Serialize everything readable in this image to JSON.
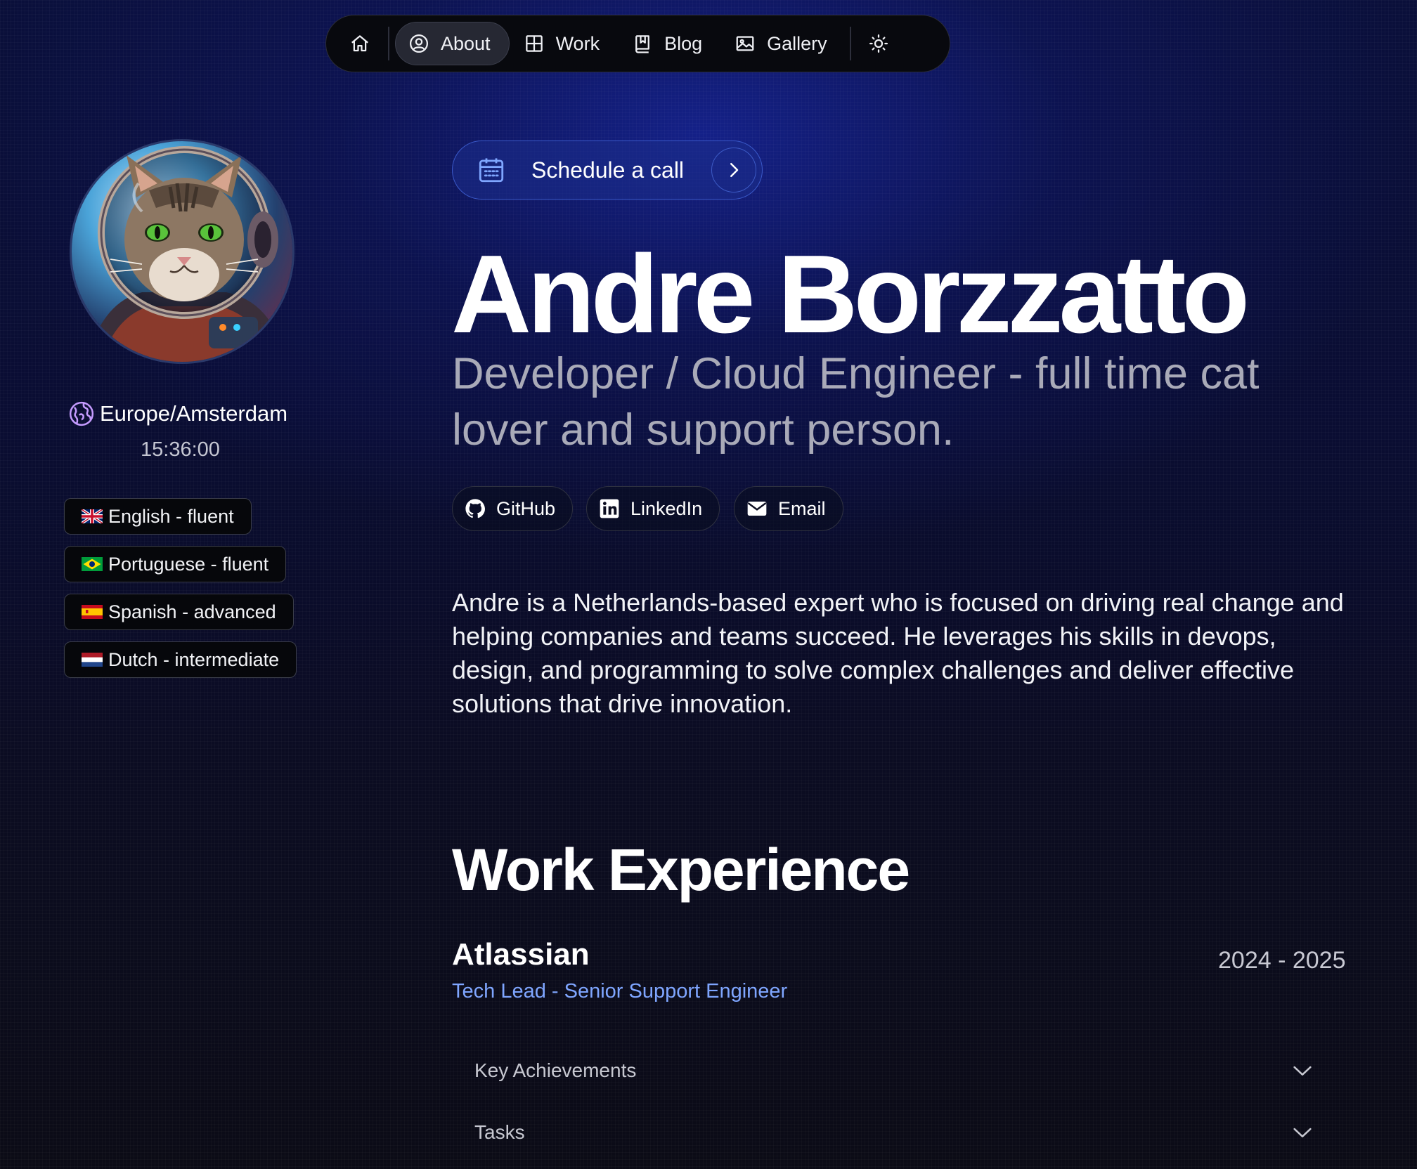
{
  "nav": {
    "items": [
      {
        "id": "home",
        "label": ""
      },
      {
        "id": "about",
        "label": "About",
        "active": true
      },
      {
        "id": "work",
        "label": "Work"
      },
      {
        "id": "blog",
        "label": "Blog"
      },
      {
        "id": "gallery",
        "label": "Gallery"
      }
    ]
  },
  "profile": {
    "timezone": "Europe/Amsterdam",
    "time": "15:36:00",
    "languages": [
      {
        "label": "English - fluent",
        "flag": "uk"
      },
      {
        "label": "Portuguese - fluent",
        "flag": "br"
      },
      {
        "label": "Spanish - advanced",
        "flag": "es"
      },
      {
        "label": "Dutch - intermediate",
        "flag": "nl"
      }
    ]
  },
  "hero": {
    "schedule_label": "Schedule a call",
    "name": "Andre Borzzatto",
    "role": "Developer / Cloud Engineer - full time cat lover and support person.",
    "social": [
      {
        "label": "GitHub",
        "icon": "github-icon"
      },
      {
        "label": "LinkedIn",
        "icon": "linkedin-icon"
      },
      {
        "label": "Email",
        "icon": "email-icon"
      }
    ],
    "bio": "Andre is a Netherlands-based expert who is focused on driving real change and helping companies and teams succeed. He leverages his skills in devops, design, and programming to solve complex challenges and deliver effective solutions that drive innovation."
  },
  "work": {
    "title": "Work Experience",
    "entries": [
      {
        "company": "Atlassian",
        "years": "2024 - 2025",
        "role": "Tech Lead - Senior Support Engineer",
        "sections": [
          "Key Achievements",
          "Tasks"
        ]
      }
    ]
  },
  "colors": {
    "accent": "#7fa6ff",
    "background": "#0a0d33",
    "schedule_bg": "#1c2e8c"
  }
}
